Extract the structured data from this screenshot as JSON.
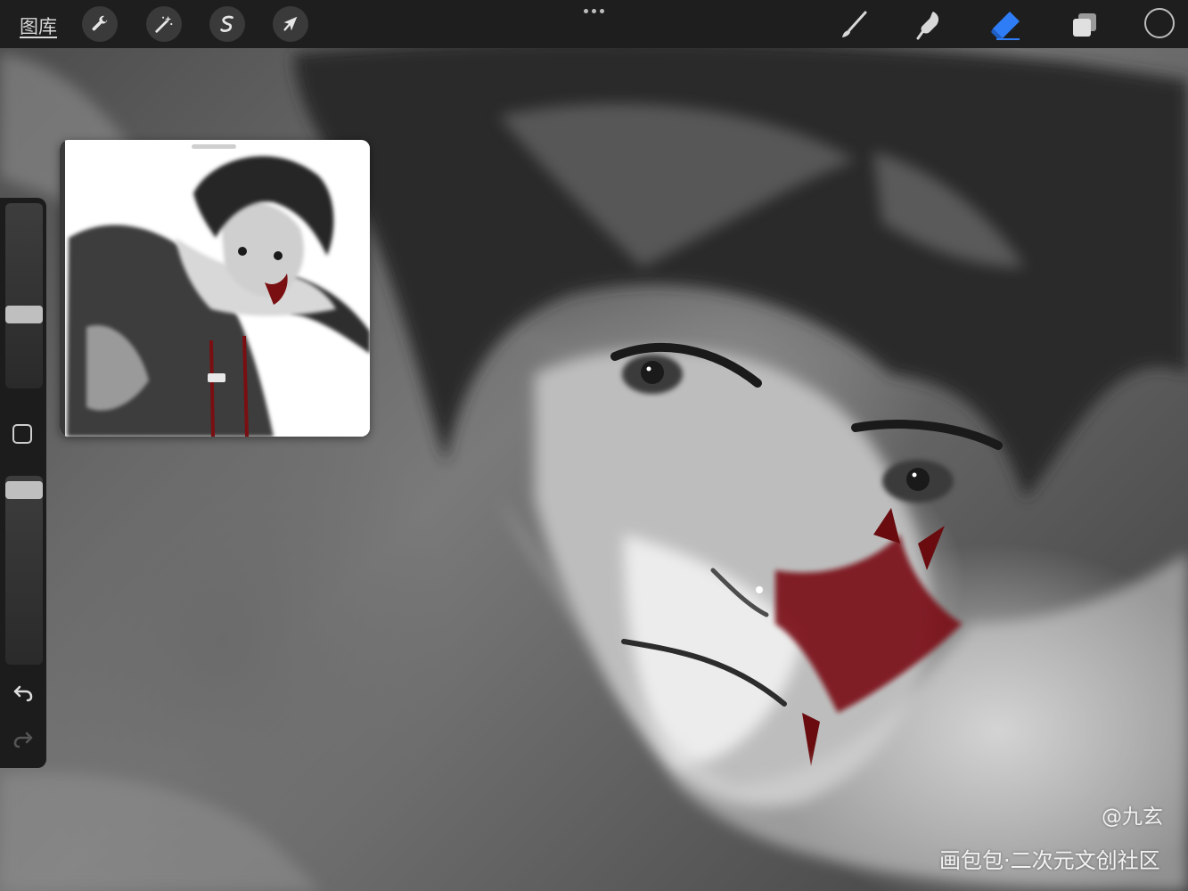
{
  "toolbar": {
    "gallery_label": "图库",
    "actions_icon": "wrench-icon",
    "adjustments_icon": "magic-wand-icon",
    "selection_icon": "selection-s-icon",
    "transform_icon": "arrow-cursor-icon",
    "more_icon": "more-dots-icon",
    "brush_icon": "brush-icon",
    "smudge_icon": "smudge-icon",
    "eraser_icon": "eraser-icon",
    "layers_icon": "layers-icon",
    "active_tool": "eraser",
    "accent_color": "#2f7df6",
    "current_color": "#1e1e1e"
  },
  "sidebar": {
    "brush_size_level": 0.38,
    "opacity_level": 1.0,
    "modify_icon": "square-modify-icon",
    "undo_icon": "undo-icon",
    "redo_icon": "redo-icon"
  },
  "reference_window": {
    "handle_icon": "drag-handle-icon"
  },
  "watermark": {
    "user": "@九玄",
    "site": "画包包·二次元文创社区"
  },
  "colors": {
    "toolbar_bg": "#1e1e1e",
    "blood_red": "#7a0f12"
  }
}
